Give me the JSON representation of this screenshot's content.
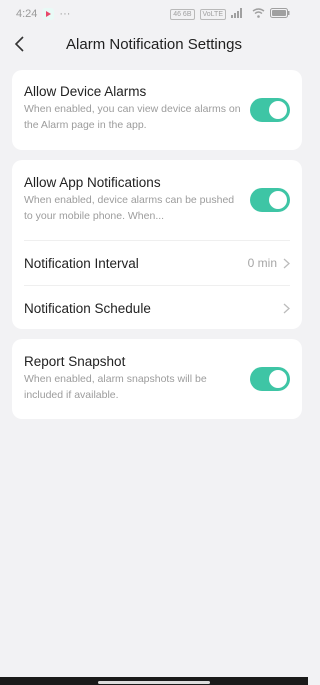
{
  "status_bar": {
    "time": "4:24",
    "dots": "···",
    "indicators": [
      "46 6B",
      "VoLTE",
      "4G",
      "wifi",
      "100"
    ]
  },
  "header": {
    "title": "Alarm Notification Settings",
    "back_icon": "chevron-left-icon"
  },
  "cards": {
    "device_alarms": {
      "title": "Allow Device Alarms",
      "description": "When enabled, you can view device alarms on the Alarm page in the app.",
      "enabled": true
    },
    "app_notifications": {
      "title": "Allow App Notifications",
      "description": "When enabled, device alarms can be pushed to your mobile phone. When...",
      "enabled": true,
      "interval_label": "Notification Interval",
      "interval_value": "0 min",
      "schedule_label": "Notification Schedule"
    },
    "snapshot": {
      "title": "Report Snapshot",
      "description": "When enabled, alarm snapshots will be included if available.",
      "enabled": true
    }
  },
  "colors": {
    "accent": "#3ec5a5",
    "background": "#f2f2f4"
  }
}
